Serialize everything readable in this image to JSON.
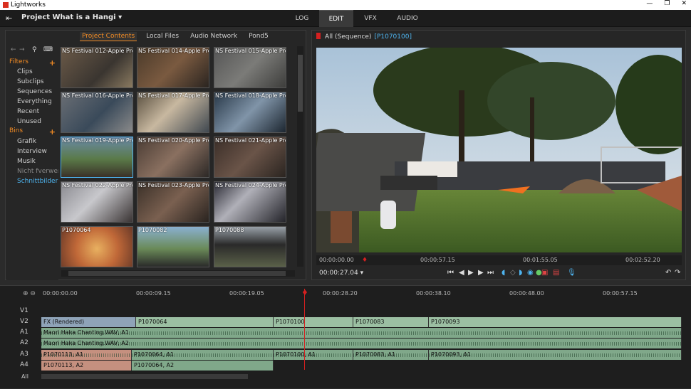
{
  "window": {
    "title": "Lightworks",
    "controls": [
      "—",
      "❐",
      "✕"
    ]
  },
  "menubar": {
    "project": "Project What is a Hangi",
    "tabs": [
      {
        "label": "LOG"
      },
      {
        "label": "EDIT"
      },
      {
        "label": "VFX"
      },
      {
        "label": "AUDIO"
      }
    ]
  },
  "browser": {
    "tabs": [
      "Project Contents",
      "Local Files",
      "Audio Network",
      "Pond5"
    ],
    "filters_label": "Filters",
    "filters": [
      "Clips",
      "Subclips",
      "Sequences",
      "Everything",
      "Recent",
      "Unused"
    ],
    "bins_label": "Bins",
    "bins": [
      "Grafik",
      "Interview",
      "Musik",
      "Nicht fverwenc",
      "Schnittbilder"
    ],
    "clips": [
      "NS Festival 012-Apple Pro",
      "NS Festival 014-Apple Pro",
      "NS Festival 015-Apple Pro",
      "NS Festival 016-Apple Pro",
      "NS Festival 017-Apple Pro",
      "NS Festival 018-Apple Pro",
      "NS Festival 019-Apple Pro",
      "NS Festival 020-Apple Pro",
      "NS Festival 021-Apple Pro",
      "NS Festival 022-Apple Pro",
      "NS Festival 023-Apple Pro",
      "NS Festival 024-Apple Pro",
      "P1070064",
      "P1070082",
      "P1070088"
    ]
  },
  "viewer": {
    "title": "All (Sequence)",
    "timecode": "[P1070100]",
    "ruler": [
      "00:00:00.00",
      "00:00:57.15",
      "00:01:55.05",
      "00:02:52.20"
    ],
    "position": "00:00:27.04"
  },
  "timeline": {
    "ruler": [
      "00:00:00.00",
      "00:00:09.15",
      "00:00:19.05",
      "00:00:28.20",
      "00:00:38.10",
      "00:00:48.00",
      "00:00:57.15"
    ],
    "tracks": [
      "V1",
      "V2",
      "A1",
      "A2",
      "A3",
      "A4"
    ],
    "all_label": "All",
    "v2": [
      "FX (Rendered)",
      "P1070064",
      "P1070100",
      "P1070083",
      "P1070093"
    ],
    "a1": "Maori Haka Chanting.WAV, A1",
    "a2": "Maori Haka Chanting.WAV, A2",
    "a3": [
      "P1070113, A1",
      "P1070064, A1",
      "P1070100, A1",
      "P1070083, A1",
      "P1070093, A1"
    ],
    "a4": [
      "P1070113, A2",
      "P1070064, A2"
    ]
  }
}
